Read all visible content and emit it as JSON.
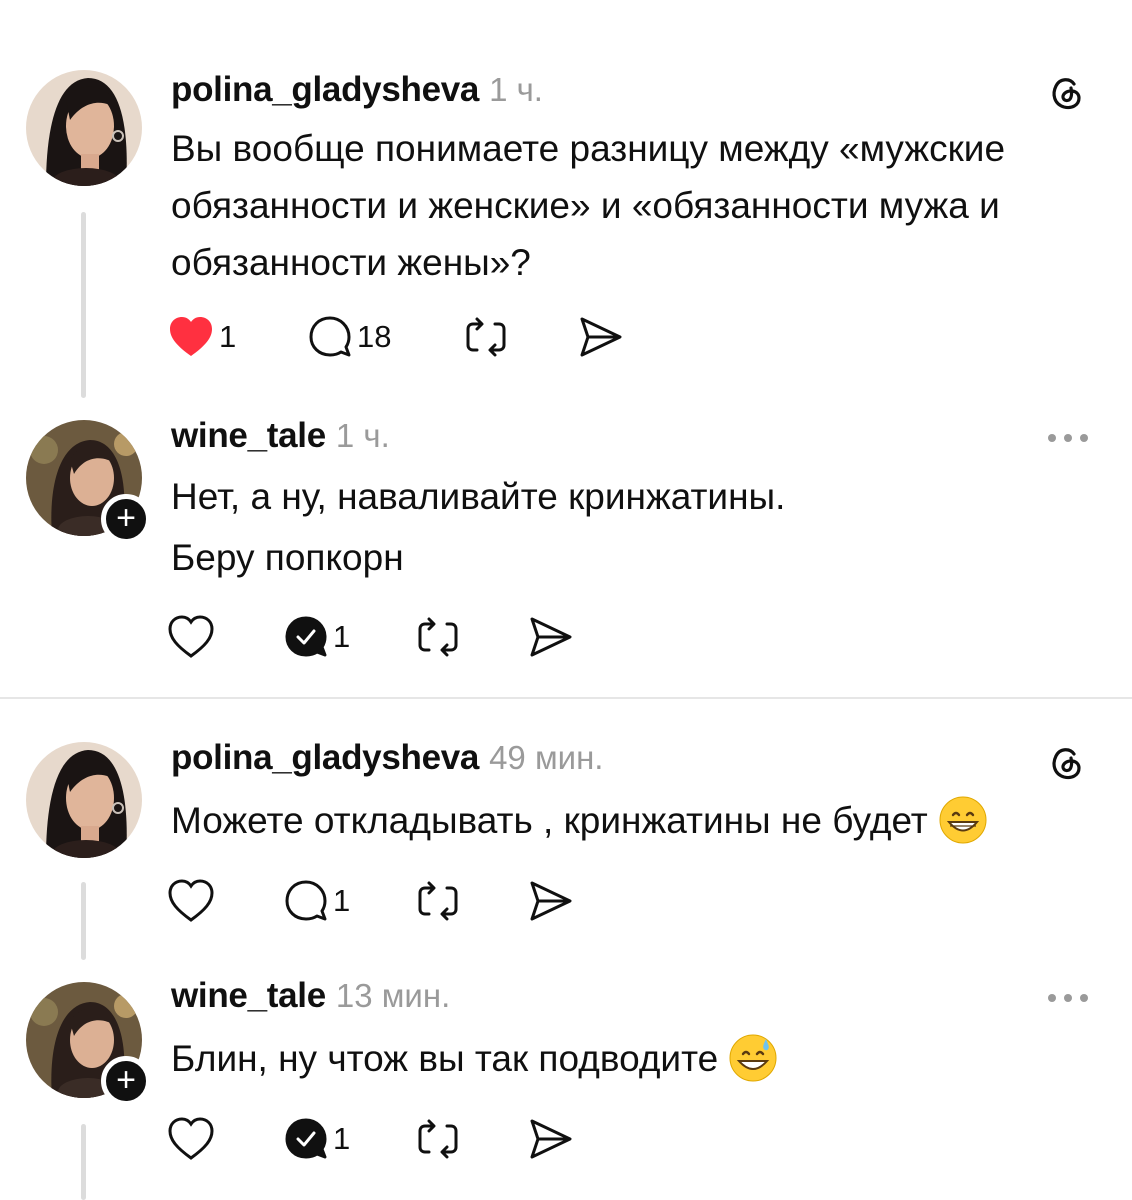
{
  "posts": [
    {
      "username": "polina_gladysheva",
      "time": "1 ч.",
      "lines": [
        "Вы вообще понимаете разницу между «мужские",
        "обязанности и женские» и «обязанности мужа и",
        "обязанности жены»?"
      ],
      "liked": true,
      "like_count": "1",
      "reply_count": "18",
      "corner_icon": "threads-logo-icon"
    },
    {
      "username": "wine_tale",
      "time": "1 ч.",
      "lines": [
        "Нет, а ну, наваливайте кринжатины.",
        "Беру попкорн"
      ],
      "liked": false,
      "like_count": "",
      "reply_count": "1",
      "corner_icon": "more-icon"
    },
    {
      "username": "polina_gladysheva",
      "time": "49 мин.",
      "lines": [
        "Можете откладывать , кринжатины не будет"
      ],
      "emoji": "grinning-face-emoji",
      "liked": false,
      "like_count": "",
      "reply_count": "1",
      "corner_icon": "threads-logo-icon"
    },
    {
      "username": "wine_tale",
      "time": "13 мин.",
      "lines": [
        "Блин, ну чтож вы так подводите"
      ],
      "emoji": "grinning-face-with-sweat-emoji",
      "liked": false,
      "like_count": "",
      "reply_count": "1",
      "corner_icon": "more-icon"
    }
  ],
  "colors": {
    "like_red": "#ff3040",
    "muted": "#9a9a9a",
    "text": "#101010"
  }
}
